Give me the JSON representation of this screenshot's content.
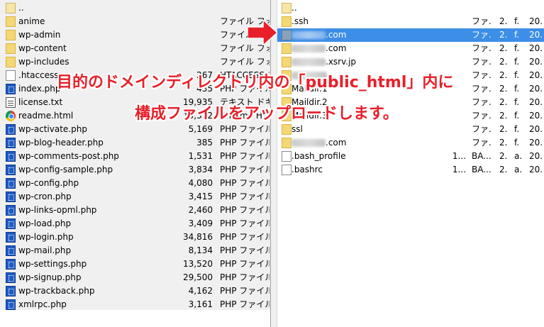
{
  "left_pane": {
    "parent_row": {
      "name": ".."
    },
    "rows": [
      {
        "icon": "folder-icon",
        "name": "anime",
        "size": "",
        "type": "ファイル フォルダー"
      },
      {
        "icon": "folder-icon",
        "name": "wp-admin",
        "size": "",
        "type": "ファイル フォルダー"
      },
      {
        "icon": "folder-icon",
        "name": "wp-content",
        "size": "",
        "type": "ファイル フォルダー"
      },
      {
        "icon": "folder-icon",
        "name": "wp-includes",
        "size": "",
        "type": "ファイル フォルダー"
      },
      {
        "icon": "file-icon",
        "name": ".htaccess",
        "size": "267",
        "type": "HTACCESS ファイル"
      },
      {
        "icon": "php-file-icon",
        "name": "index.php",
        "size": "435",
        "type": "PHP ファイル"
      },
      {
        "icon": "text-file-icon",
        "name": "license.txt",
        "size": "19,935",
        "type": "テキスト ドキュメント"
      },
      {
        "icon": "chrome-html-icon",
        "name": "readme.html",
        "size": "10,312",
        "type": "Chrome HTML"
      },
      {
        "icon": "php-file-icon",
        "name": "wp-activate.php",
        "size": "5,169",
        "type": "PHP ファイル"
      },
      {
        "icon": "php-file-icon",
        "name": "wp-blog-header.php",
        "size": "385",
        "type": "PHP ファイル"
      },
      {
        "icon": "php-file-icon",
        "name": "wp-comments-post.php",
        "size": "1,531",
        "type": "PHP ファイル"
      },
      {
        "icon": "php-file-icon",
        "name": "wp-config-sample.php",
        "size": "3,834",
        "type": "PHP ファイル"
      },
      {
        "icon": "php-file-icon",
        "name": "wp-config.php",
        "size": "4,080",
        "type": "PHP ファイル"
      },
      {
        "icon": "php-file-icon",
        "name": "wp-cron.php",
        "size": "3,415",
        "type": "PHP ファイル"
      },
      {
        "icon": "php-file-icon",
        "name": "wp-links-opml.php",
        "size": "2,460",
        "type": "PHP ファイル"
      },
      {
        "icon": "php-file-icon",
        "name": "wp-load.php",
        "size": "3,409",
        "type": "PHP ファイル"
      },
      {
        "icon": "php-file-icon",
        "name": "wp-login.php",
        "size": "34,816",
        "type": "PHP ファイル"
      },
      {
        "icon": "php-file-icon",
        "name": "wp-mail.php",
        "size": "8,134",
        "type": "PHP ファイル"
      },
      {
        "icon": "php-file-icon",
        "name": "wp-settings.php",
        "size": "13,520",
        "type": "PHP ファイル"
      },
      {
        "icon": "php-file-icon",
        "name": "wp-signup.php",
        "size": "29,500",
        "type": "PHP ファイル"
      },
      {
        "icon": "php-file-icon",
        "name": "wp-trackback.php",
        "size": "4,162",
        "type": "PHP ファイル"
      },
      {
        "icon": "php-file-icon",
        "name": "xmlrpc.php",
        "size": "3,161",
        "type": "PHP ファイル"
      }
    ]
  },
  "right_pane": {
    "parent_row": {
      "name": ".."
    },
    "rows": [
      {
        "icon": "folder-icon",
        "name": ".ssh",
        "blurred": false,
        "size": "",
        "type": "ファ...",
        "f1": "2.",
        "f2": "f.",
        "f3": "20..."
      },
      {
        "icon": "folder-icon",
        "name": ".com",
        "blurred": true,
        "selected": true,
        "size": "",
        "type": "ファ...",
        "f1": "2.",
        "f2": "f.",
        "f3": "20..."
      },
      {
        "icon": "folder-icon",
        "name": ".com",
        "blurred": true,
        "size": "",
        "type": "ファ...",
        "f1": "2.",
        "f2": "f.",
        "f3": "20..."
      },
      {
        "icon": "folder-icon",
        "name": ".xsrv.jp",
        "blurred": true,
        "size": "",
        "type": "ファ...",
        "f1": "2.",
        "f2": "f.",
        "f3": "20..."
      },
      {
        "icon": "folder-icon",
        "name": "",
        "blurred": true,
        "size": "",
        "type": "ファ...",
        "f1": "2.",
        "f2": "f.",
        "f3": "20..."
      },
      {
        "icon": "folder-icon",
        "name": "Maildir.1",
        "blurred": false,
        "size": "",
        "type": "ファ...",
        "f1": "2.",
        "f2": "f.",
        "f3": "20..."
      },
      {
        "icon": "folder-icon",
        "name": "Maildir.2",
        "blurred": false,
        "size": "",
        "type": "ファ...",
        "f1": "2.",
        "f2": "f.",
        "f3": "20..."
      },
      {
        "icon": "folder-icon",
        "name": "Maildir.3",
        "blurred": false,
        "size": "",
        "type": "ファ...",
        "f1": "2.",
        "f2": "f.",
        "f3": "20..."
      },
      {
        "icon": "folder-icon",
        "name": "ssl",
        "blurred": false,
        "size": "",
        "type": "ファ...",
        "f1": "2.",
        "f2": "f.",
        "f3": "20..."
      },
      {
        "icon": "folder-icon",
        "name": ".com",
        "blurred": true,
        "size": "",
        "type": "ファ...",
        "f1": "2.",
        "f2": "f.",
        "f3": "20..."
      },
      {
        "icon": "file-icon",
        "name": ".bash_profile",
        "blurred": false,
        "size": "1...",
        "type": "BA...",
        "f1": "2.",
        "f2": "a.",
        "f3": "20..."
      },
      {
        "icon": "file-icon",
        "name": ".bashrc",
        "blurred": false,
        "size": "1...",
        "type": "BA...",
        "f1": "2.",
        "f2": "a.",
        "f3": "20..."
      }
    ]
  },
  "annotation": {
    "line1": "目的のドメインディレクトリ内の「public_html」内に",
    "line2": "構成ファイルをアップロードします。",
    "color": "#e8202a"
  },
  "colors": {
    "selection": "#3d8ee6",
    "folder": "#f5d774",
    "php": "#1e5bc6"
  }
}
